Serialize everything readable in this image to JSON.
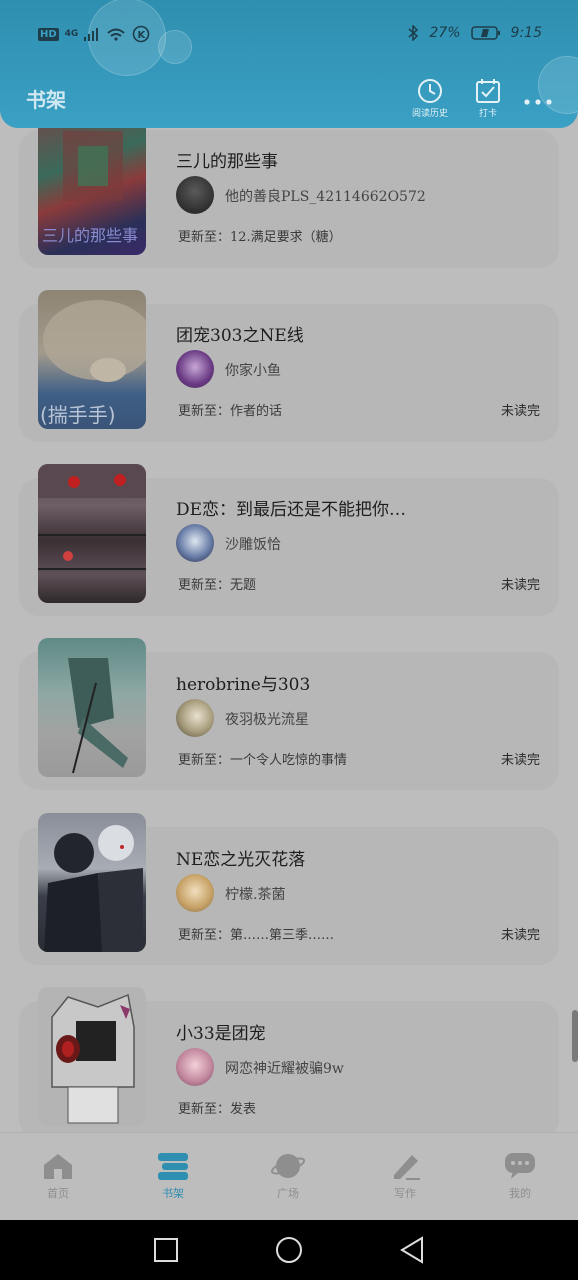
{
  "status": {
    "network": "4G",
    "battery": "27%",
    "time": "9:15"
  },
  "header": {
    "title": "书架",
    "history_label": "阅读历史",
    "checkin_label": "打卡"
  },
  "books": [
    {
      "title": "三儿的那些事",
      "author": "他的善良PLS_42114662O572",
      "update": "更新至：12.满足要求（糖）",
      "unread": ""
    },
    {
      "title": "团宠303之NE线",
      "author": "你家小鱼",
      "update": "更新至：作者的话",
      "unread": "未读完"
    },
    {
      "title": "DE恋：到最后还是不能把你…",
      "author": "沙雕饭恰",
      "update": "更新至：无题",
      "unread": "未读完"
    },
    {
      "title": "herobrine与303",
      "author": "夜羽极光流星",
      "update": "更新至：一个令人吃惊的事情",
      "unread": "未读完"
    },
    {
      "title": "NE恋之光灭花落",
      "author": "柠檬.茶菌",
      "update": "更新至：第……第三季……",
      "unread": "未读完"
    },
    {
      "title": "小33是团宠",
      "author": "网恋神近耀被骗9w",
      "update": "更新至：发表",
      "unread": ""
    }
  ],
  "tabs": [
    {
      "label": "首页"
    },
    {
      "label": "书架"
    },
    {
      "label": "广场"
    },
    {
      "label": "写作"
    },
    {
      "label": "我的"
    }
  ],
  "colors": {
    "accent": "#2f8fb0",
    "header": "#3aa0c4",
    "card": "#b7b7b7"
  }
}
